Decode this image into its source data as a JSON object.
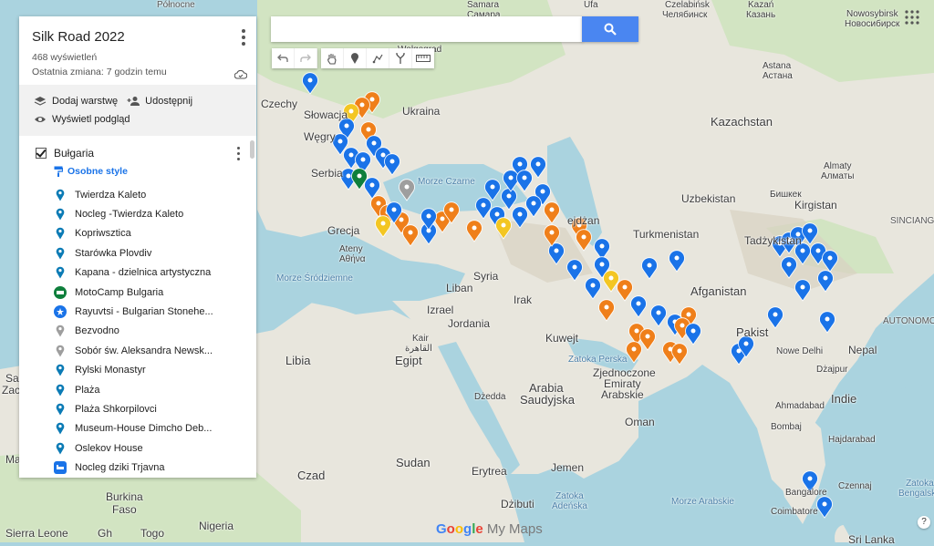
{
  "map": {
    "brand": {
      "google": "Google",
      "my_maps": "My Maps"
    },
    "labels": {
      "polnocne": "Północne",
      "kazan": "Kazań",
      "kazan_ru": "Казань",
      "ufa": "Ufa",
      "czelabinsk": "Czelabińsk",
      "czelabinsk_ru": "Челябинск",
      "nowosybirsk": "Nowosybirsk",
      "nowosybirsk_ru": "Новосибирск",
      "samara": "Samara",
      "samara_ru": "Самара",
      "astana": "Astana",
      "astana_ru": "Астана",
      "wolgograd": "Wołgograd",
      "czechy": "Czechy",
      "slowacja": "Słowacja",
      "ukraina": "Ukraina",
      "wegry": "Węgry",
      "serbia": "Serbia",
      "kazachstan": "Kazachstan",
      "morze_czarne": "Morze Czarne",
      "uzbekistan": "Uzbekistan",
      "almaty": "Almaty",
      "almaty_kz": "Алматы",
      "biszkek": "Бишкек",
      "kirgistan": "Kirgistan",
      "grecja": "Grecja",
      "ateny": "Ateny",
      "ateny_gr": "Αθήνα",
      "turkmenistan": "Turkmenistan",
      "azerbejdzan": "ejdżan",
      "tadzykistan": "Tadżykistan",
      "sinciang": "SINCIANG",
      "syria": "Syria",
      "liban": "Liban",
      "morze_srodziemne": "Morze\nŚródziemne",
      "izrael": "Izrael",
      "irak": "Irak",
      "jordania": "Jordania",
      "afganistan": "Afganistan",
      "pakistan": "Pakist",
      "kair": "Kair",
      "kair_ar": "القاهرة",
      "kuwejt": "Kuwejt",
      "libia": "Libia",
      "egipt": "Egipt",
      "zatoka_perska": "Zatoka Perska",
      "zjednoczone": "Zjednoczone",
      "emiraty": "Emiraty",
      "arabskie": "Arabskie",
      "nowe_delhi": "Nowe Delhi",
      "nepal": "Nepal",
      "dzajpur": "Dżajpur",
      "autonomous": "AUTONOMOU",
      "dzedda": "Dżedda",
      "arabia": "Arabia",
      "saudyjska": "Saudyjska",
      "oman": "Oman",
      "indie": "Indie",
      "ahmadabad": "Ahmadabad",
      "bombaj": "Bombaj",
      "hajdarabad": "Hajdarabad",
      "czad": "Czad",
      "sudan": "Sudan",
      "erytrea": "Erytrea",
      "jemen": "Jemen",
      "dzibuti": "Dżibuti",
      "zatoka_adenska": "Zatoka\nAdeńska",
      "morze_arabskie": "Morze Arabskie",
      "bengalska": "Zatoka\nBengalska",
      "bangalore": "Bangalore",
      "czennaj": "Czennaj",
      "coimbatore": "Coimbatore",
      "sri_lanka": "Sri Lanka",
      "burkina": "Burkina\nFaso",
      "nigeria": "Nigeria",
      "sierra": "Sierra Leone",
      "togo": "Togo",
      "gh": "Gh",
      "mali": "Mali",
      "sa": "Sa",
      "zac": "Zac"
    }
  },
  "panel": {
    "title": "Silk Road 2022",
    "views": "468 wyświetleń",
    "last_change": "Ostatnia zmiana: 7 godzin temu",
    "add_layer": "Dodaj warstwę",
    "share": "Udostępnij",
    "preview": "Wyświetl podgląd",
    "layer": {
      "name": "Bułgaria",
      "style_label": "Osobne style",
      "items": [
        {
          "label": "Twierdza Kaleto",
          "icon": "pin-icon",
          "color": "#0b7bb5"
        },
        {
          "label": "Nocleg -Twierdza Kaleto",
          "icon": "pin-icon",
          "color": "#0b7bb5"
        },
        {
          "label": "Kopriwsztica",
          "icon": "pin-icon",
          "color": "#0b7bb5"
        },
        {
          "label": "Starówka Plovdiv",
          "icon": "pin-icon",
          "color": "#0b7bb5"
        },
        {
          "label": "Kapana - dzielnica artystyczna",
          "icon": "pin-icon",
          "color": "#0b7bb5"
        },
        {
          "label": "MotoCamp Bulgaria",
          "icon": "camper-icon",
          "color": "#0f7f3c"
        },
        {
          "label": "Rayuvtsi - Bulgarian Stonehe...",
          "icon": "star-icon",
          "color": "#1a73e8"
        },
        {
          "label": "Bezvodno",
          "icon": "pin-icon",
          "color": "#9e9e9e"
        },
        {
          "label": "Sobór św. Aleksandra Newsk...",
          "icon": "pin-icon",
          "color": "#9e9e9e"
        },
        {
          "label": "Rylski Monastyr",
          "icon": "pin-icon",
          "color": "#0b7bb5"
        },
        {
          "label": "Plaża",
          "icon": "pin-icon",
          "color": "#0b7bb5"
        },
        {
          "label": "Plaża Shkorpilovci",
          "icon": "pin-icon",
          "color": "#0b7bb5"
        },
        {
          "label": "Museum-House Dimcho Deb...",
          "icon": "pin-icon",
          "color": "#0b7bb5"
        },
        {
          "label": "Oslekov House",
          "icon": "pin-icon",
          "color": "#0b7bb5"
        },
        {
          "label": "Nocleg dziki Trjavna",
          "icon": "bed-icon",
          "color": "#1a73e8"
        }
      ]
    }
  },
  "search": {
    "placeholder": "",
    "value": ""
  },
  "help_label": "?",
  "colors": {
    "blue": "#1a73e8",
    "teal": "#0b7bb5",
    "orange": "#ef7f1a",
    "gray": "#9e9e9e",
    "yellow": "#f3c623",
    "green": "#0f7f3c"
  }
}
